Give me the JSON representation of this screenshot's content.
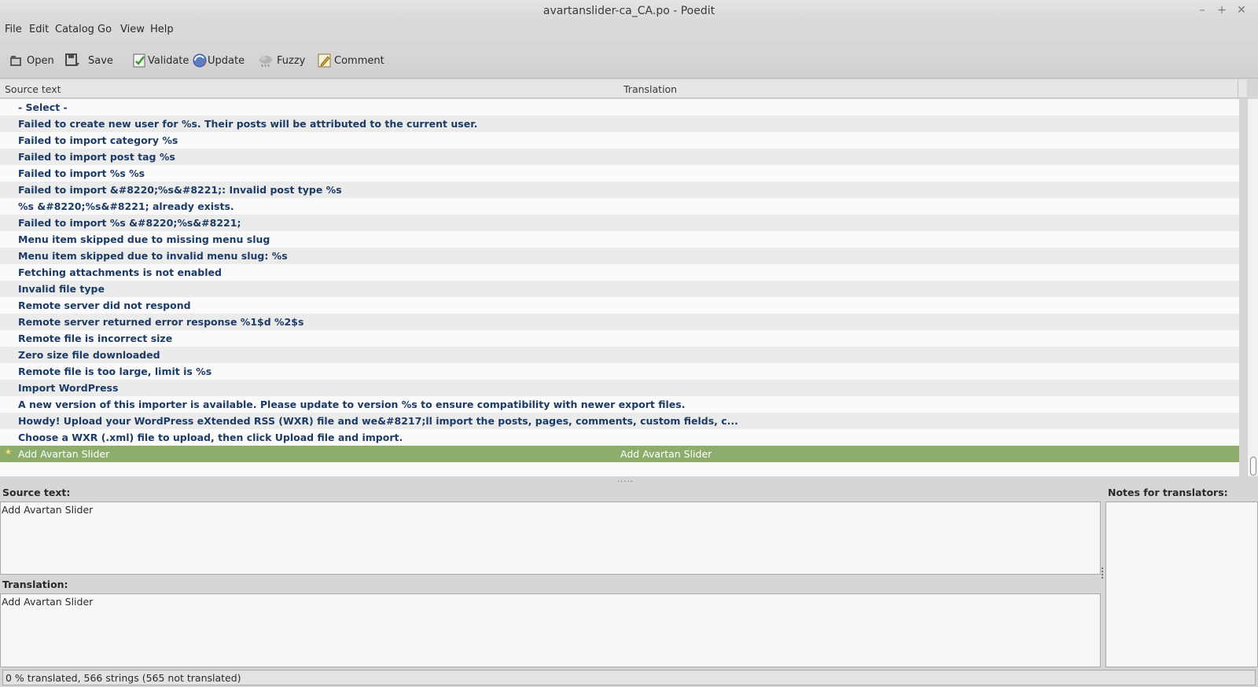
{
  "window": {
    "title": "avartanslider-ca_CA.po - Poedit",
    "controls": {
      "minimize": "–",
      "maximize": "+",
      "close": "✕"
    }
  },
  "menu": [
    "File",
    "Edit",
    "Catalog",
    "Go",
    "View",
    "Help"
  ],
  "toolbar": {
    "open": "Open",
    "save": "Save",
    "validate": "Validate",
    "update": "Update",
    "fuzzy": "Fuzzy",
    "comment": "Comment"
  },
  "list": {
    "headers": {
      "source": "Source text",
      "translation": "Translation"
    },
    "rows": [
      {
        "source": "- Select -",
        "translation": ""
      },
      {
        "source": "Failed to create new user for %s. Their posts will be attributed to the current user.",
        "translation": ""
      },
      {
        "source": "Failed to import category %s",
        "translation": ""
      },
      {
        "source": "Failed to import post tag %s",
        "translation": ""
      },
      {
        "source": "Failed to import %s %s",
        "translation": ""
      },
      {
        "source": "Failed to import &#8220;%s&#8221;: Invalid post type %s",
        "translation": ""
      },
      {
        "source": "%s &#8220;%s&#8221; already exists.",
        "translation": ""
      },
      {
        "source": "Failed to import %s &#8220;%s&#8221;",
        "translation": ""
      },
      {
        "source": "Menu item skipped due to missing menu slug",
        "translation": ""
      },
      {
        "source": "Menu item skipped due to invalid menu slug: %s",
        "translation": ""
      },
      {
        "source": "Fetching attachments is not enabled",
        "translation": ""
      },
      {
        "source": "Invalid file type",
        "translation": ""
      },
      {
        "source": "Remote server did not respond",
        "translation": ""
      },
      {
        "source": "Remote server returned error response %1$d %2$s",
        "translation": ""
      },
      {
        "source": "Remote file is incorrect size",
        "translation": ""
      },
      {
        "source": "Zero size file downloaded",
        "translation": ""
      },
      {
        "source": "Remote file is too large, limit is %s",
        "translation": ""
      },
      {
        "source": "Import WordPress",
        "translation": ""
      },
      {
        "source": "A new version of this importer is available. Please update to version %s to ensure compatibility with newer export files.",
        "translation": ""
      },
      {
        "source": "Howdy! Upload your WordPress eXtended RSS (WXR) file and we&#8217;ll import the posts, pages, comments, custom fields, c...",
        "translation": ""
      },
      {
        "source": "Choose a WXR (.xml) file to upload, then click Upload file and import.",
        "translation": ""
      },
      {
        "source": "Add Avartan Slider",
        "translation": "Add Avartan Slider",
        "selected": true
      }
    ]
  },
  "editor": {
    "source_label": "Source text:",
    "source_value": "Add Avartan Slider",
    "translation_label": "Translation:",
    "translation_value": "Add Avartan Slider",
    "notes_label": "Notes for translators:"
  },
  "status": "0 % translated, 566 strings (565 not translated)",
  "colors": {
    "selected_row": "#8dad6d",
    "untranslated_text": "#1c3b66"
  }
}
